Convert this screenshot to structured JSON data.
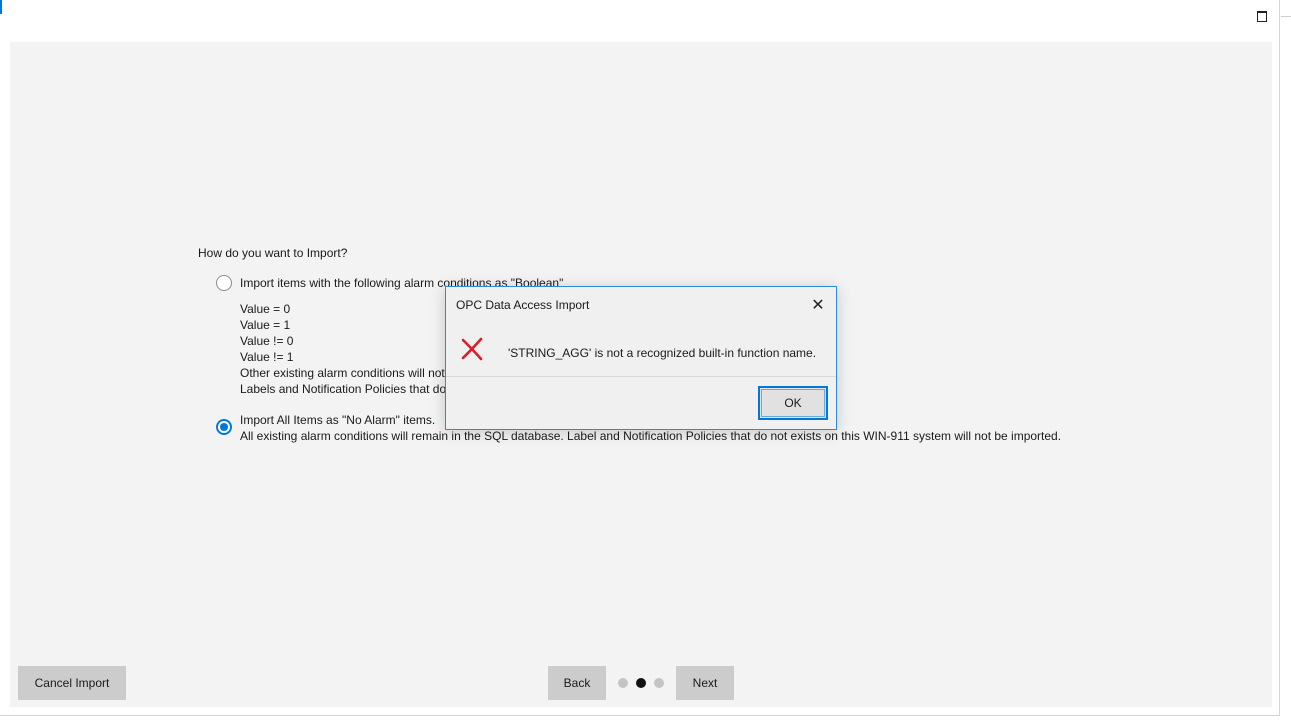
{
  "window": {
    "restore_icon": "restore-window-icon",
    "accent_color": "#0078d7"
  },
  "wizard": {
    "question": "How do you want to Import?",
    "option_boolean": {
      "label": "Import items with the following alarm conditions as \"Boolean\"",
      "selected": false,
      "conditions": [
        "Value = 0",
        "Value = 1",
        "Value != 0",
        "Value != 1"
      ],
      "note_other": "Other existing alarm conditions will not",
      "note_labels": "Labels and Notification Policies that do"
    },
    "option_no_alarm": {
      "label": "Import All Items as \"No Alarm\" items.",
      "description": "All existing alarm conditions will remain in the SQL database. Label and Notification Policies that do not exists on this WIN-911 system will not be imported.",
      "selected": true
    }
  },
  "footer": {
    "cancel_label": "Cancel Import",
    "back_label": "Back",
    "next_label": "Next",
    "steps": {
      "total": 3,
      "current": 2
    }
  },
  "dialog": {
    "title": "OPC Data Access Import",
    "message": "'STRING_AGG' is not a recognized built-in function name.",
    "ok_label": "OK",
    "icon": "error-x-icon",
    "close_icon": "close-icon",
    "icon_color": "#d81e2a",
    "border_color": "#2f8ad6"
  }
}
